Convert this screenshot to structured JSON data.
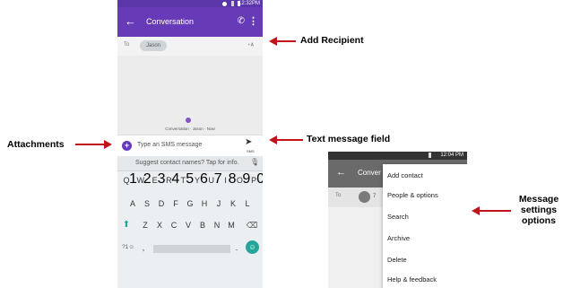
{
  "phone1": {
    "status_time": "12:32PM",
    "toolbar": {
      "back_icon": "←",
      "title": "Conversation"
    },
    "recipient": {
      "to_label": "To",
      "chip": "Jason"
    },
    "conversation_hint": "Conversation · Jason · Now",
    "compose": {
      "attach_icon": "+",
      "placeholder": "Type an SMS message",
      "send_label": "SMS"
    },
    "keyboard": {
      "suggestion": "Suggest contact names? Tap for info.",
      "row1": [
        [
          "Q",
          "1"
        ],
        [
          "W",
          "2"
        ],
        [
          "E",
          "3"
        ],
        [
          "R",
          "4"
        ],
        [
          "T",
          "5"
        ],
        [
          "Y",
          "6"
        ],
        [
          "U",
          "7"
        ],
        [
          "I",
          "8"
        ],
        [
          "O",
          "9"
        ],
        [
          "P",
          "0"
        ]
      ],
      "row2": [
        "A",
        "S",
        "D",
        "F",
        "G",
        "H",
        "J",
        "K",
        "L"
      ],
      "row3": [
        "Z",
        "X",
        "C",
        "V",
        "B",
        "N",
        "M"
      ],
      "symbols_key": "?1☺",
      "comma_key": ",",
      "period_key": "."
    }
  },
  "phone2": {
    "status_time": "12:04 PM",
    "toolbar": {
      "back_icon": "←",
      "title": "Conver"
    },
    "recipient": {
      "to_label": "To",
      "chip": "7"
    },
    "menu": [
      "Add contact",
      "People & options",
      "Search",
      "Archive",
      "Delete",
      "Help & feedback"
    ]
  },
  "annotations": {
    "add_recipient": "Add Recipient",
    "attachments": "Attachments",
    "text_field": "Text message field",
    "menu_lines": [
      "Message",
      "settings",
      "options"
    ]
  },
  "colors": {
    "accent": "#673ab7",
    "annotation_arrow": "#c0141a",
    "key_accent": "#26a69a"
  }
}
